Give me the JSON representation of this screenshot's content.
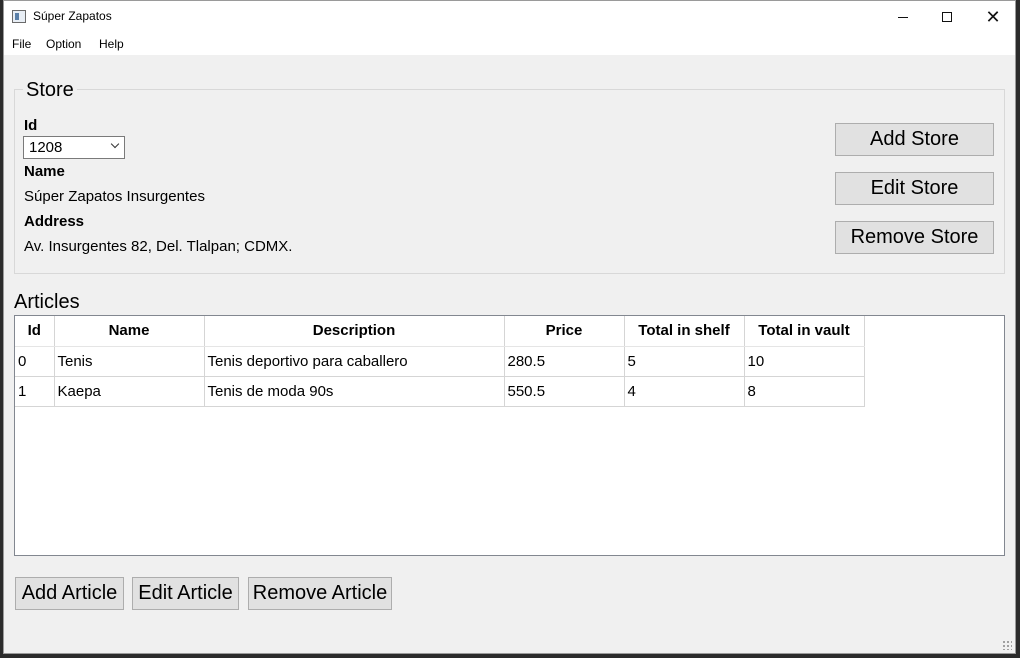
{
  "window": {
    "title": "Súper Zapatos"
  },
  "menu": [
    "File",
    "Option",
    "Help"
  ],
  "store": {
    "group_title": "Store",
    "id_label": "Id",
    "id_value": "1208",
    "name_label": "Name",
    "name_value": "Súper Zapatos Insurgentes",
    "address_label": "Address",
    "address_value": "Av. Insurgentes 82, Del. Tlalpan; CDMX.",
    "buttons": {
      "add": "Add Store",
      "edit": "Edit Store",
      "remove": "Remove Store"
    }
  },
  "articles": {
    "title": "Articles",
    "columns": [
      "Id",
      "Name",
      "Description",
      "Price",
      "Total in shelf",
      "Total in vault"
    ],
    "rows": [
      [
        "0",
        "Tenis",
        "Tenis deportivo para caballero",
        "280.5",
        "5",
        "10"
      ],
      [
        "1",
        "Kaepa",
        "Tenis de moda 90s",
        "550.5",
        "4",
        "8"
      ]
    ],
    "buttons": {
      "add": "Add Article",
      "edit": "Edit Article",
      "remove": "Remove Article"
    }
  }
}
